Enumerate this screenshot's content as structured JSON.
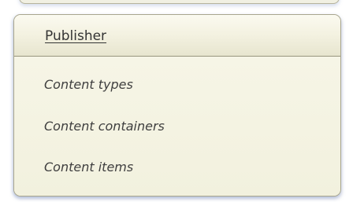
{
  "panel": {
    "title": "Publisher",
    "items": [
      {
        "label": "Content types"
      },
      {
        "label": "Content containers"
      },
      {
        "label": "Content items"
      }
    ]
  },
  "colors": {
    "panel_background": "#f6f5e7",
    "panel_border": "#a9a68e",
    "text": "#3f3f3f"
  }
}
